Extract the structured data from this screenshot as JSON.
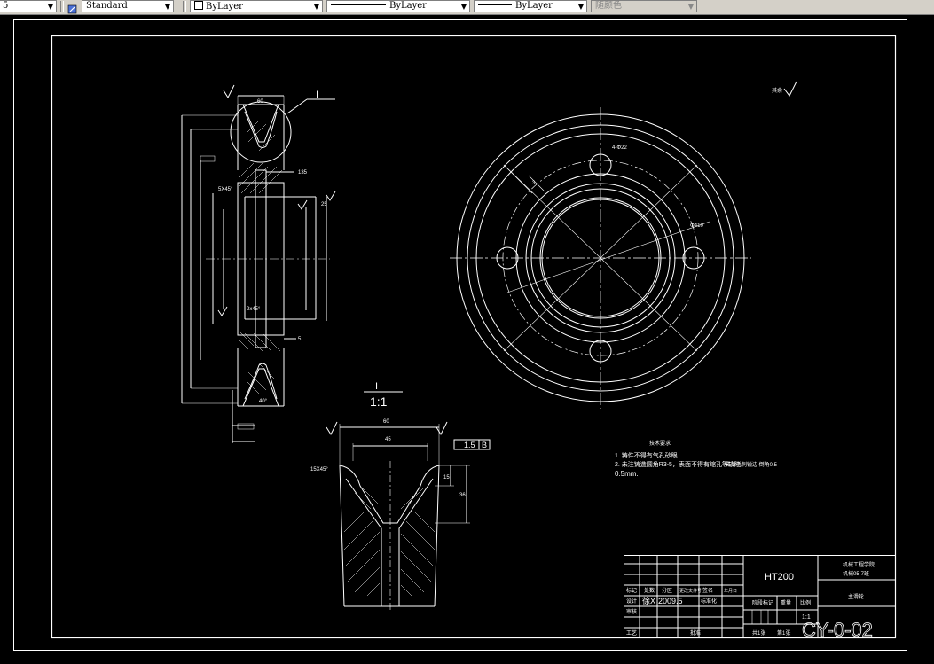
{
  "toolbar": {
    "layer_value": "5",
    "text_style": "Standard",
    "color": "ByLayer",
    "linetype": "ByLayer",
    "lineweight": "ByLayer",
    "plot_style": "随颜色"
  },
  "drawing": {
    "detail_label": "I",
    "scale_label": "I",
    "scale_value": "1:1",
    "dims_detail": {
      "width_60": "60",
      "width_45": "45",
      "angle": "15X45°",
      "tol": "1.5",
      "ref": "B",
      "d15": "15",
      "d36": "36"
    },
    "dims_section": {
      "top": "60",
      "right": "135",
      "d25": "25",
      "small": "5",
      "chamfer1": "5X45°",
      "chamfer2": "2x45°",
      "angle": "40°",
      "label_I": "I"
    },
    "notes_title": "技术要求",
    "notes": [
      "1. 铸件不得有气孔砂眼",
      "2. 未注铸造圆角R3-5，表面不得有缩孔等缺陷",
      "0.5mm."
    ],
    "note_right": "去除毛刺锐边 倒角0.5",
    "roughness_mark": "其余"
  },
  "title_block": {
    "material": "HT200",
    "school": "机械工程学院",
    "class": "机械05-7班",
    "part_name": "主滑轮",
    "designer_label": "设计",
    "designer_name": "徐X",
    "date": "2009.5",
    "checker_label": "审核",
    "approve_label": "批准",
    "std_label": "标准化",
    "process_label": "工艺",
    "stage_label": "阶段标记",
    "weight_label": "重量",
    "scale_label": "比例",
    "sheet_label": "共1张",
    "sheet_no": "第1张",
    "ratio": "1:1",
    "mark_label": "标记",
    "count_label": "处数",
    "zone_label": "分区",
    "doc_label": "更改文件号",
    "sign_label": "签名",
    "ymd_label": "年月日",
    "drawing_no": "CY-0-02"
  }
}
